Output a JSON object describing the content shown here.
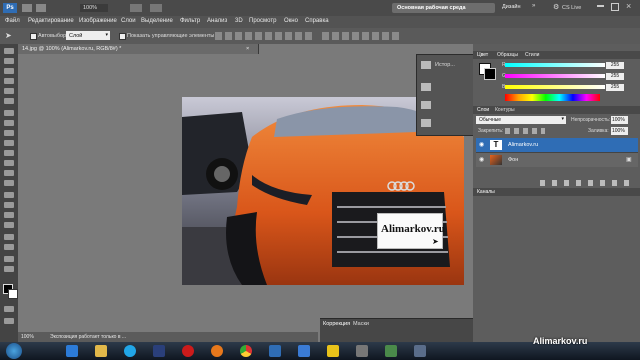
{
  "appbar": {
    "zoom": "100%",
    "workspace_label": "Основная рабочая среда",
    "design_label": "Дизайн",
    "cslive_label": "CS Live"
  },
  "menu": [
    "Файл",
    "Редактирование",
    "Изображение",
    "Слои",
    "Выделение",
    "Фильтр",
    "Анализ",
    "3D",
    "Просмотр",
    "Окно",
    "Справка"
  ],
  "options": {
    "autoselect": "Автовыбор:",
    "layer_select": "Слой",
    "show_controls": "Показать управляющие элементы"
  },
  "document": {
    "tab_title": "14.jpg @ 100% (Alimarkov.ru, RGB/8#) *",
    "plate_text": "Alimarkov.ru"
  },
  "history_mini": {
    "label": "Истор..."
  },
  "color_panel": {
    "tabs": [
      "Цвет",
      "Образцы",
      "Стили"
    ],
    "channels": [
      {
        "name": "R",
        "value": "255"
      },
      {
        "name": "G",
        "value": "255"
      },
      {
        "name": "B",
        "value": "255"
      }
    ]
  },
  "layers_panel": {
    "tabs": [
      "Слои",
      "Контуры"
    ],
    "blend_mode": "Обычные",
    "opacity_label": "Непрозрачность:",
    "opacity_value": "100%",
    "lock_label": "Закрепить:",
    "fill_label": "Заливка:",
    "fill_value": "100%",
    "layers": [
      {
        "name": "Alimarkov.ru",
        "kind": "text",
        "selected": true
      },
      {
        "name": "Фон",
        "kind": "image",
        "selected": false
      }
    ]
  },
  "channels_panel": {
    "label": "Каналы"
  },
  "corrections_panel": {
    "tabs": [
      "Коррекция",
      "Маски"
    ]
  },
  "status": {
    "zoom": "100%",
    "message": "Экспозиция работает только в ..."
  },
  "watermark": "Alimarkov.ru",
  "colors": {
    "accent_orange": "#e8621a",
    "selection_blue": "#2f6db5",
    "chrome_dark": "#4a4a4a"
  }
}
